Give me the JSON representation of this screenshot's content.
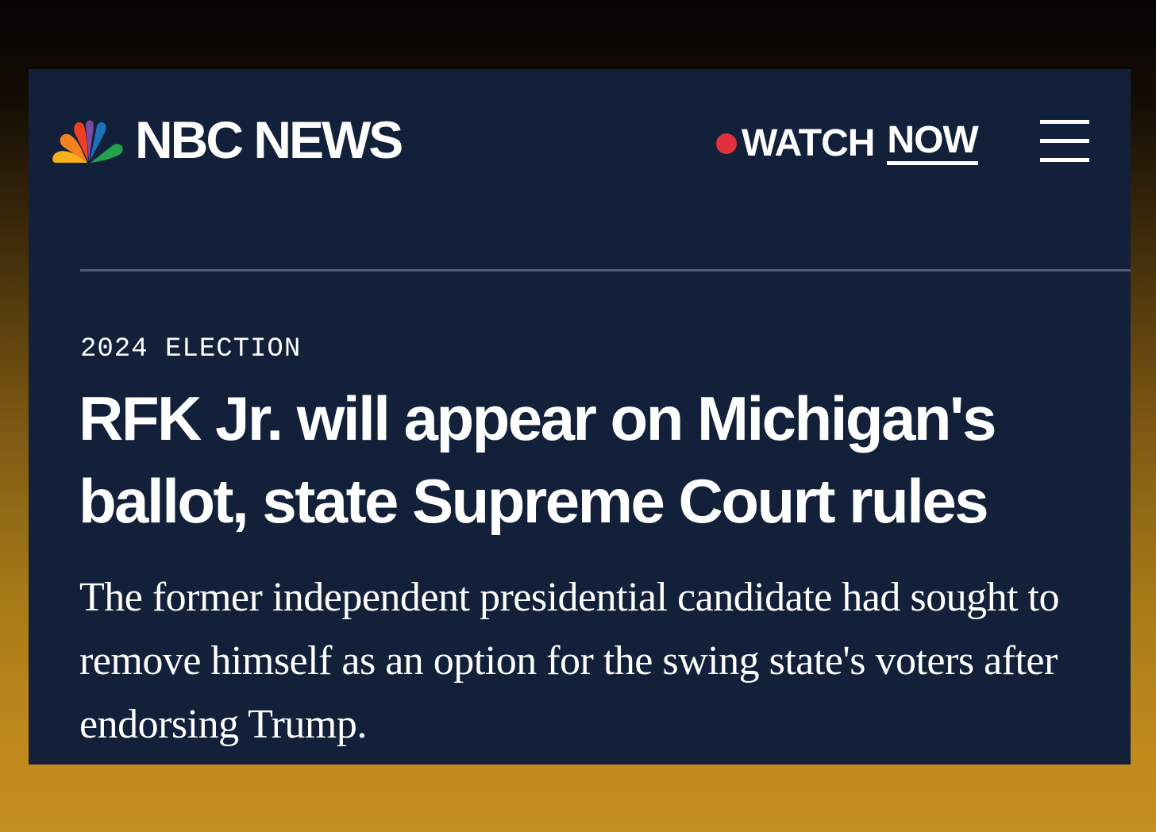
{
  "header": {
    "brand_name": "NBC NEWS",
    "logo_icon": "nbc-peacock-icon",
    "watch_label": "WATCH",
    "watch_now_label": "NOW",
    "live_dot_color": "#e2313d",
    "menu_icon": "hamburger-menu-icon"
  },
  "article": {
    "section": "2024 ELECTION",
    "headline": "RFK Jr. will appear on Michigan's ballot, state Supreme Court rules",
    "dek": "The former independent presidential candidate had sought to remove himself as an option for the swing state's voters after endorsing Trump."
  },
  "colors": {
    "card_background": "#13203a",
    "text": "#ffffff",
    "divider": "#4f5c74",
    "peacock_feathers": [
      "#f6b21a",
      "#ef4023",
      "#7b4b9e",
      "#1e6fb8",
      "#23a24d",
      "#f58220"
    ]
  }
}
